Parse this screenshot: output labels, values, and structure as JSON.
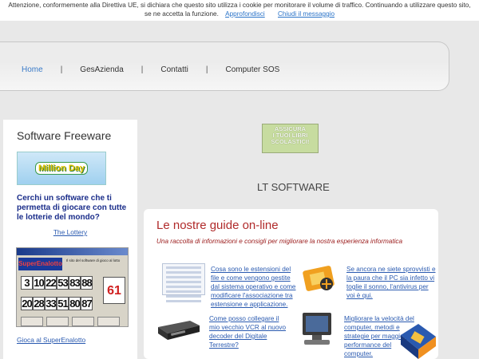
{
  "cookie": {
    "line1": "Attenzione, conformemente alla Direttiva UE, si dichiara che questo sito utilizza i cookie per monitorare il volume di traffico. Continuando a utilizzare questo sito,",
    "line2": "se ne accetta la funzione.",
    "learn_more": "Approfondisci",
    "close": "Chiudi il messaggio"
  },
  "nav": {
    "items": [
      {
        "label": "Home"
      },
      {
        "label": "GesAzienda"
      },
      {
        "label": "Contatti"
      },
      {
        "label": "Computer SOS"
      }
    ],
    "separator": "|",
    "colors": {
      "active": "#3a7bc8"
    }
  },
  "sidebar": {
    "title": "Software Freeware",
    "banner_text": "Million Day",
    "question": "Cerchi un software che ti permetta di giocare con tutte le lotterie del mondo?",
    "lottery_link": "The Lottery",
    "superenalotto": {
      "logo": "SuperEnalotto",
      "caption": "Il sito del software di gioco al lotto",
      "row1": [
        "3",
        "10",
        "22",
        "53",
        "83",
        "88"
      ],
      "row2": [
        "20",
        "28",
        "33",
        "51",
        "80",
        "87"
      ],
      "jolly": "61"
    },
    "play_link": "Gioca al SuperEnalotto"
  },
  "main": {
    "ad_text": [
      "ASSICURA",
      "I TUOI LIBRI",
      "SCOLASTICI!"
    ],
    "title": "LT SOFTWARE",
    "guides": {
      "title": "Le nostre guide on-line",
      "subtitle": "Una raccolta di informazioni e consigli per migliorare la nostra esperienza informatica",
      "items": [
        {
          "text": "Cosa sono le estensioni del file e come vengono gestite dal sistema operativo e come modificare l'associazione tra estensione e applicazione.",
          "icon": "file-list-icon"
        },
        {
          "text": "Se ancora ne siete sprovvisti e la paura che il PC sia infetto vi toglie il sonno, l'antivirus per voi è qui.",
          "icon": "antivirus-icon"
        },
        {
          "text": "Come posso collegare il mio vecchio VCR al nuovo decoder del Digitale Terrestre?",
          "icon": "vcr-icon"
        },
        {
          "text": "Migliorare la velocità del computer, metodi e strategie per maggiori performance del computer.",
          "icon": "computer-icon"
        }
      ],
      "software_box_icon": "software-box-icon"
    }
  }
}
